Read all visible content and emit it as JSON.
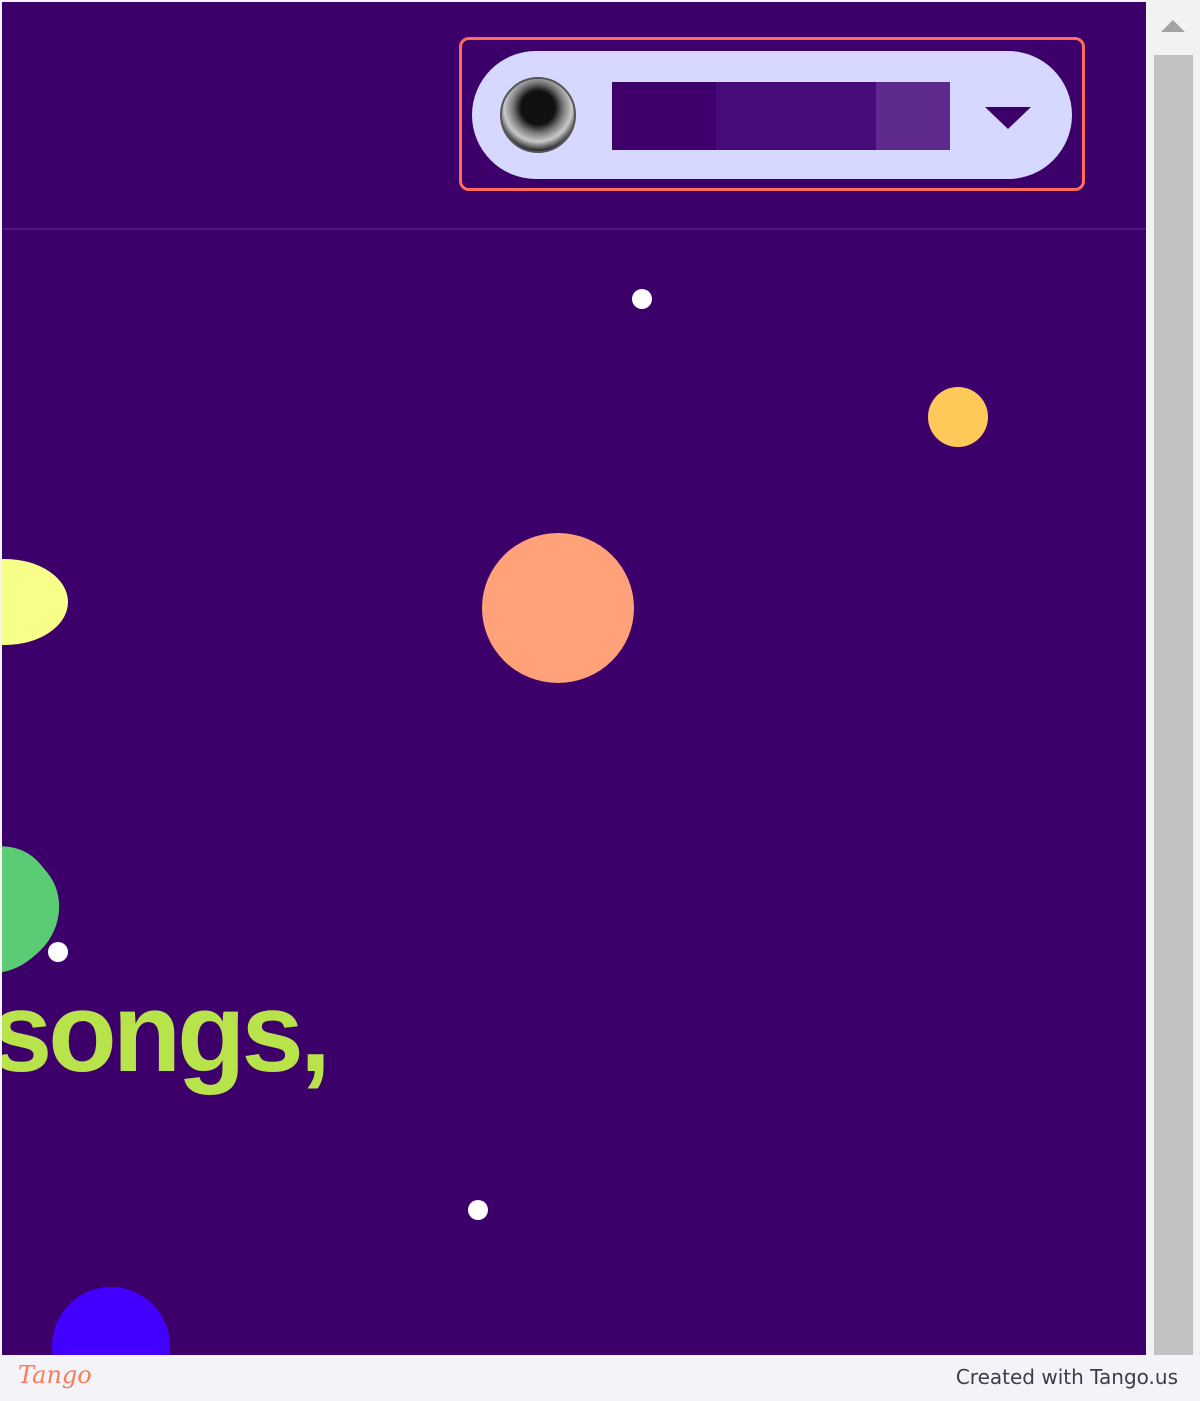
{
  "header": {
    "account_menu": {
      "avatar_icon": "user-avatar-photo",
      "username_redacted": true,
      "chevron_icon": "chevron-down-icon"
    }
  },
  "hero": {
    "text": "songs,"
  },
  "colors": {
    "background": "#3d006b",
    "pill": "#d6d8ff",
    "highlight": "#ff6b5e",
    "hero_text": "#b8e34a",
    "dot_white": "#ffffff",
    "dot_yellow": "#ffc95a",
    "dot_peach": "#ffa27a",
    "dot_lime": "#f7ff88",
    "dot_green": "#5ccc74",
    "dot_blue": "#4200ff"
  },
  "footer": {
    "logo": "Tango",
    "credit": "Created with Tango.us"
  }
}
